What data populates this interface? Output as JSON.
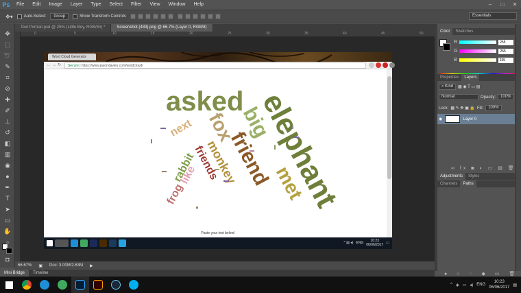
{
  "app": {
    "name": "Ps"
  },
  "menus": [
    "File",
    "Edit",
    "Image",
    "Layer",
    "Type",
    "Select",
    "Filter",
    "View",
    "Window",
    "Help"
  ],
  "options": {
    "auto_select_label": "Auto-Select:",
    "auto_select_value": "Group",
    "transform_label": "Show Transform Controls",
    "workspace": "Essentials"
  },
  "doc_tabs": [
    "Text Portrait.psd @ 25% (Little Boy, RGB/8#) *",
    "Screenshot (489).png @ 66.7% (Layer 0, RGB/8)"
  ],
  "ruler_ticks": [
    "0",
    "5",
    "10",
    "15",
    "20",
    "25",
    "30",
    "35",
    "40",
    "45",
    "50"
  ],
  "browser": {
    "tab_title": "Word Cloud Generator",
    "secure": "Secure",
    "url": "https://www.jasondavies.com/wordcloud/",
    "paste_text": "Paste your text below!"
  },
  "wordcloud": {
    "words": [
      {
        "text": "elephant",
        "color": "#6e7f3a"
      },
      {
        "text": "asked",
        "color": "#7f8e4a"
      },
      {
        "text": "friend",
        "color": "#8a5a28"
      },
      {
        "text": "big",
        "color": "#9bb068"
      },
      {
        "text": "fox",
        "color": "#b8a070"
      },
      {
        "text": "met",
        "color": "#b5a040"
      },
      {
        "text": "monkey",
        "color": "#b48f3a"
      },
      {
        "text": "friends",
        "color": "#9d3a32"
      },
      {
        "text": "rabbit",
        "color": "#7f9d4a"
      },
      {
        "text": "frog",
        "color": "#c07070"
      },
      {
        "text": "like",
        "color": "#e2a0b0"
      },
      {
        "text": "next",
        "color": "#d8b078"
      }
    ]
  },
  "inner_taskbar": {
    "lang": "ENG",
    "time": "10:23",
    "date": "06/06/2017"
  },
  "status": {
    "zoom": "66.67%",
    "doc": "Doc: 3.00M/2.63M"
  },
  "bottom_tabs": [
    "Mini Bridge",
    "Timeline"
  ],
  "color_panel": {
    "tabs": [
      "Color",
      "Swatches"
    ],
    "r_label": "R",
    "g_label": "G",
    "b_label": "B",
    "r": "255",
    "g": "255",
    "b": "255"
  },
  "layers_panel": {
    "tabs": [
      "Properties",
      "Layers"
    ],
    "kind": "Kind",
    "blend": "Normal",
    "opacity_label": "Opacity:",
    "opacity": "100%",
    "lock_label": "Lock:",
    "fill_label": "Fill:",
    "fill": "100%",
    "layer_name": "Layer 0"
  },
  "adjust_panel": {
    "tabs": [
      "Adjustments",
      "Styles"
    ]
  },
  "channels_panel": {
    "tabs": [
      "Channels",
      "Paths"
    ]
  },
  "taskbar": {
    "lang": "ENG",
    "time": "10:23",
    "date": "06/06/2017"
  },
  "colors": {
    "accent": "#31a8ff",
    "layer_selected": "#6a7f94"
  }
}
